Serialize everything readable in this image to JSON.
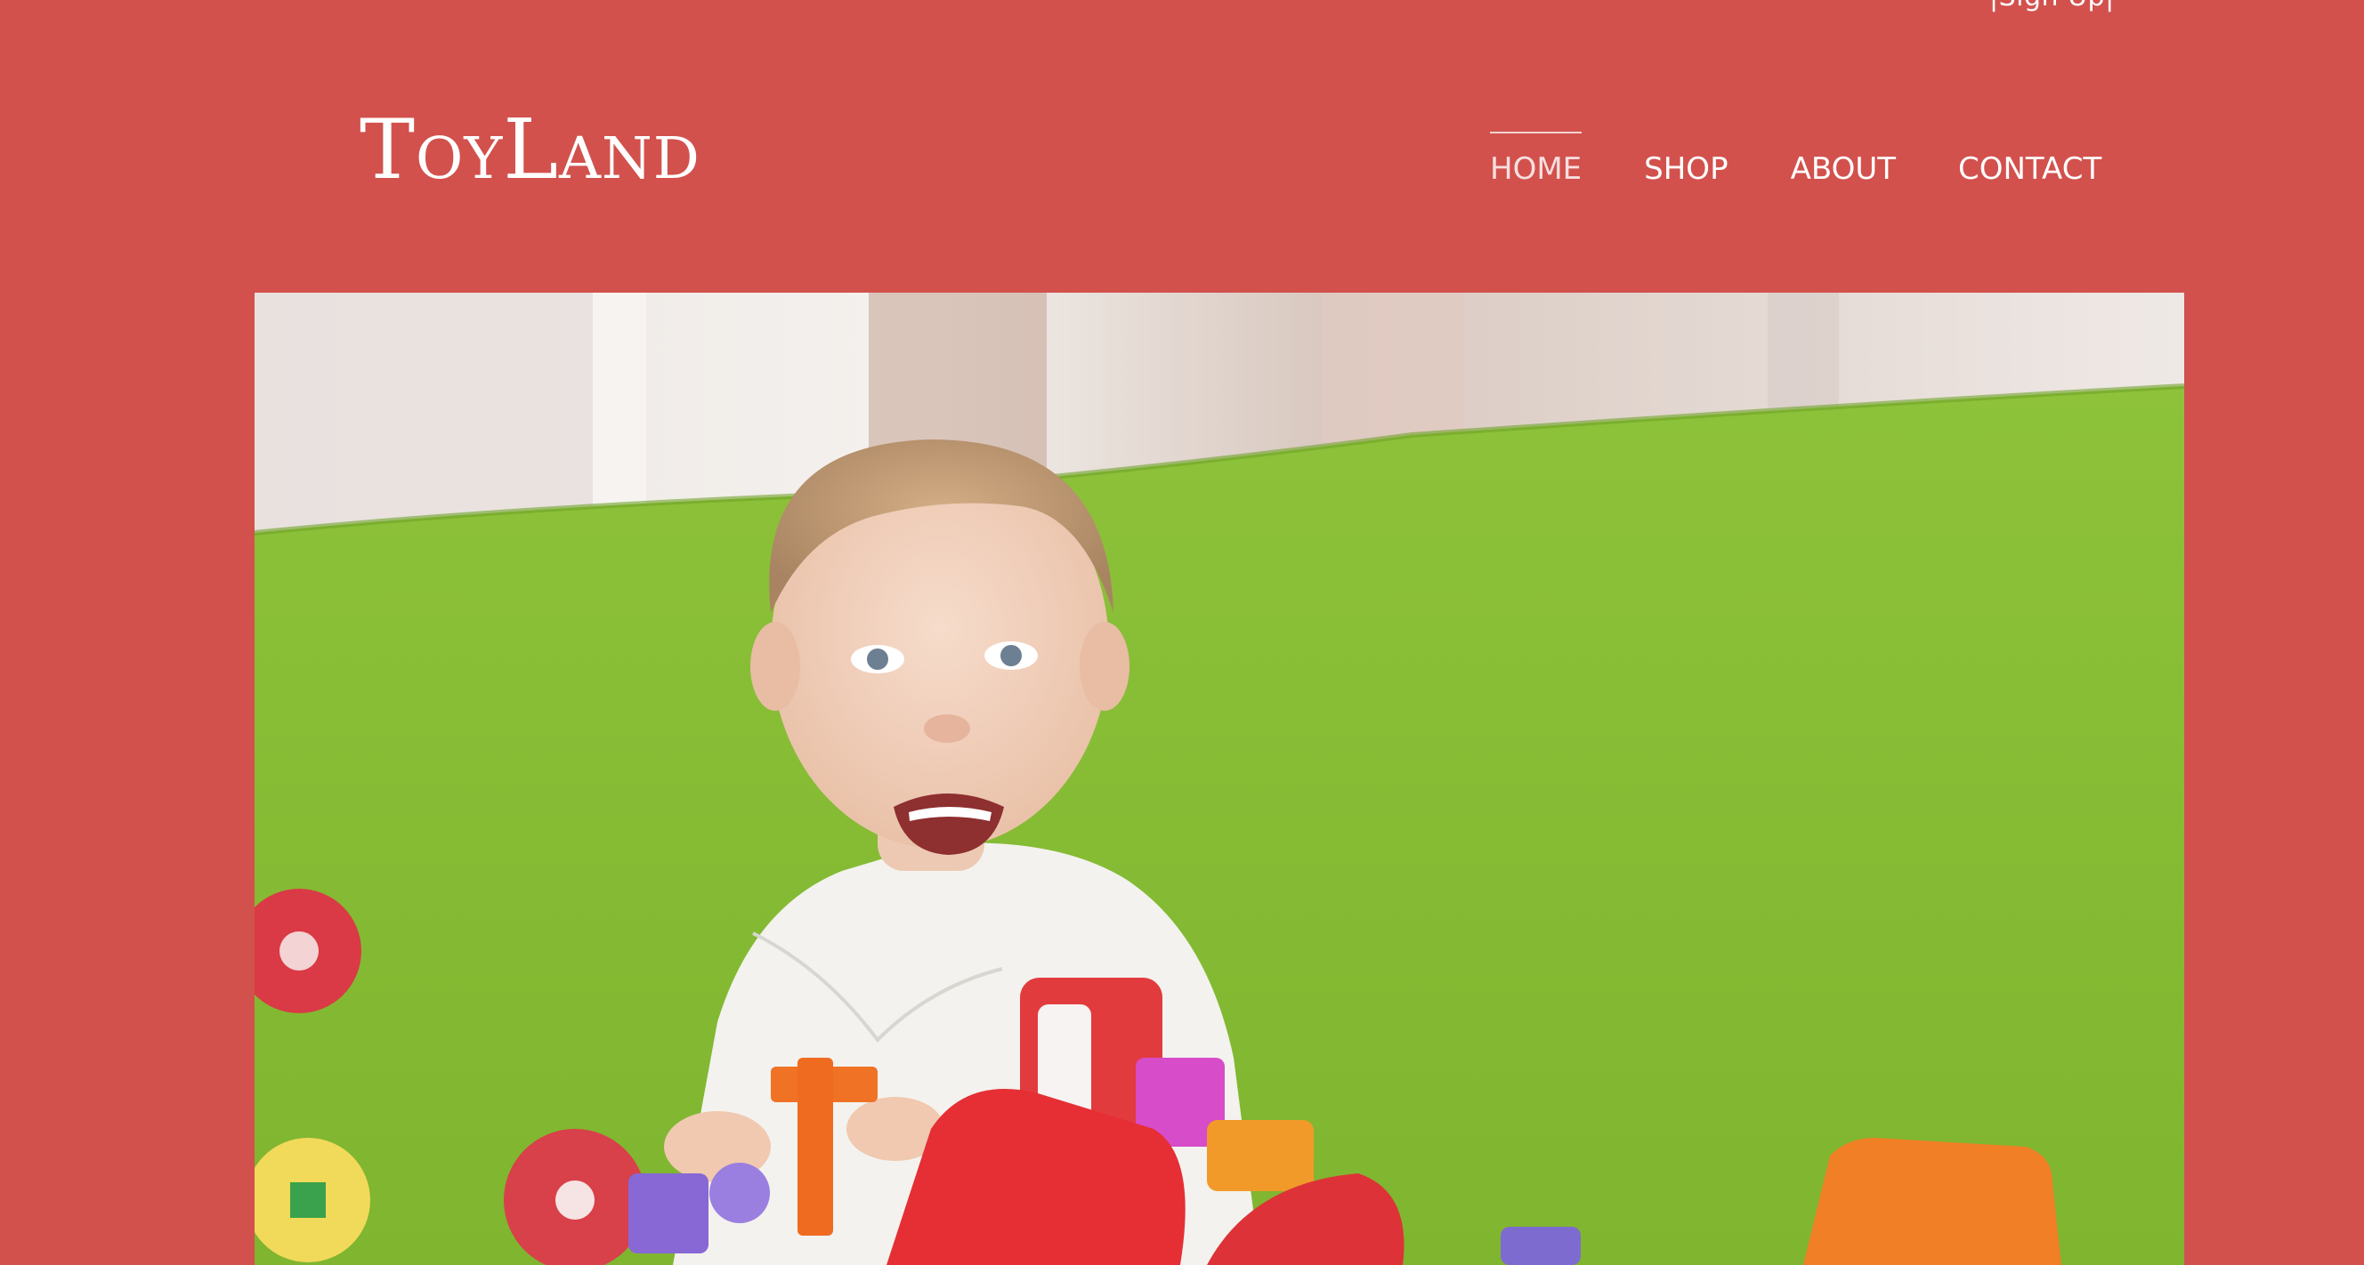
{
  "header": {
    "signup_label": "|Sign Up|",
    "logo_text": "ToyLand"
  },
  "nav": {
    "items": [
      {
        "label": "HOME",
        "active": true
      },
      {
        "label": "SHOP",
        "active": false
      },
      {
        "label": "ABOUT",
        "active": false
      },
      {
        "label": "CONTACT",
        "active": false
      }
    ]
  },
  "colors": {
    "page_background": "#d2514d",
    "text": "#ffffff"
  },
  "hero": {
    "description_icon": "photo-of-smiling-child-playing-with-toy-blocks"
  }
}
